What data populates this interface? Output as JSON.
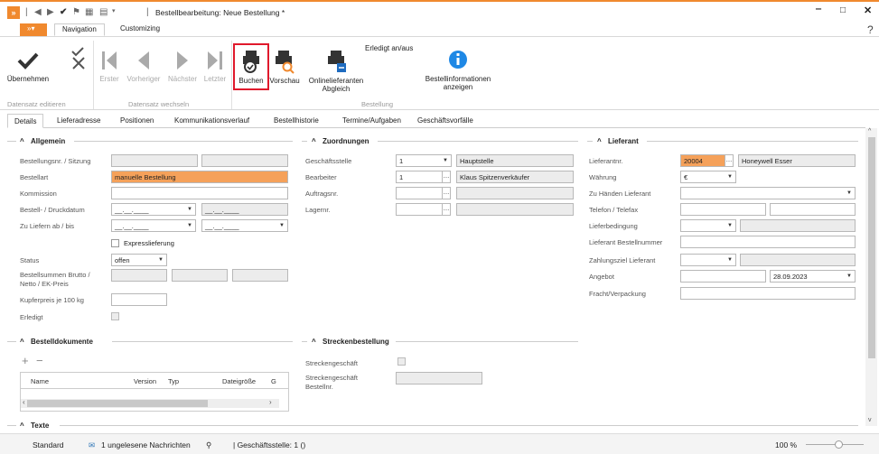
{
  "window": {
    "title": "Bestellbearbeitung: Neue Bestellung *",
    "help": "?"
  },
  "ribbon": {
    "tabs": [
      "Navigation",
      "Customizing"
    ],
    "buttons": {
      "uebernehmen": "Übernehmen",
      "erster": "Erster",
      "vorheriger": "Vorheriger",
      "naechster": "Nächster",
      "letzter": "Letzter",
      "buchen": "Buchen",
      "vorschau": "Vorschau",
      "online_abgleich": "Onlinelieferanten Abgleich",
      "erledigt": "Erledigt an/aus",
      "bestellinfo": "Bestellinformationen anzeigen"
    },
    "groups": {
      "datensatz_editieren": "Datensatz editieren",
      "datensatz_wechseln": "Datensatz wechseln",
      "bestellung": "Bestellung"
    }
  },
  "detail_tabs": [
    "Details",
    "Lieferadresse",
    "Positionen",
    "Kommunikationsverlauf",
    "Bestellhistorie",
    "Termine/Aufgaben",
    "Geschäftsvorfälle"
  ],
  "allgemein": {
    "title": "Allgemein",
    "labels": {
      "nr": "Bestellungsnr. / Sitzung",
      "art": "Bestellart",
      "kommission": "Kommission",
      "druckdatum": "Bestell- / Druckdatum",
      "liefern": "Zu Liefern ab / bis",
      "express": "Expresslieferung",
      "status": "Status",
      "summen": "Bestellsummen Brutto / Netto / EK-Preis",
      "kupfer": "Kupferpreis je 100 kg",
      "erledigt": "Erledigt"
    },
    "values": {
      "art": "manuelle Bestellung",
      "date_placeholder": "__.__.____",
      "status": "offen"
    }
  },
  "zuordnungen": {
    "title": "Zuordnungen",
    "labels": {
      "geschaeftsstelle": "Geschäftsstelle",
      "bearbeiter": "Bearbeiter",
      "auftragsnr": "Auftragsnr.",
      "lagernr": "Lagernr."
    },
    "values": {
      "gs_nr": "1",
      "gs_name": "Hauptstelle",
      "bearb_nr": "1",
      "bearb_name": "Klaus Spitzenverkäufer"
    }
  },
  "lieferant": {
    "title": "Lieferant",
    "labels": {
      "nr": "Lieferantnr.",
      "waehrung": "Währung",
      "zu_haenden": "Zu Händen Lieferant",
      "telefon": "Telefon / Telefax",
      "lieferbedingung": "Lieferbedingung",
      "bestellnummer": "Lieferant Bestellnummer",
      "zahlungsziel": "Zahlungsziel Lieferant",
      "angebot": "Angebot",
      "fracht": "Fracht/Verpackung"
    },
    "values": {
      "nr": "20004",
      "name": "Honeywell Esser",
      "waehrung": "€",
      "angebot_datum": "28.09.2023"
    }
  },
  "bestelldokumente": {
    "title": "Bestelldokumente",
    "columns": [
      "Name",
      "Version",
      "Typ",
      "Dateigröße",
      "G"
    ]
  },
  "streckenbestellung": {
    "title": "Streckenbestellung",
    "labels": {
      "geschaeft": "Streckengeschäft",
      "bestellnr": "Streckengeschäft Bestellnr."
    }
  },
  "texte": {
    "title": "Texte"
  },
  "statusbar": {
    "mode": "Standard",
    "messages": "1 ungelesene Nachrichten",
    "gs": "| Geschäftsstelle: 1 ()",
    "zoom": "100 %"
  }
}
